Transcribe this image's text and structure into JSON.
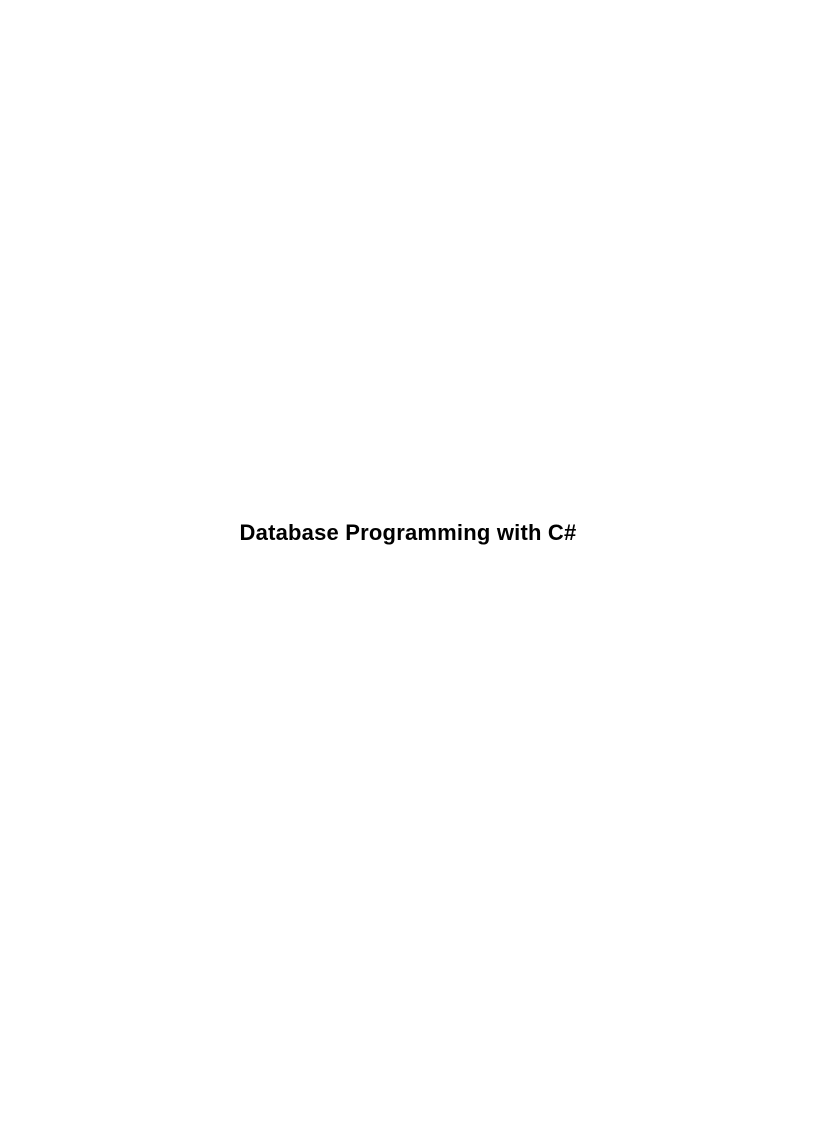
{
  "document": {
    "title": "Database Programming with C#"
  }
}
